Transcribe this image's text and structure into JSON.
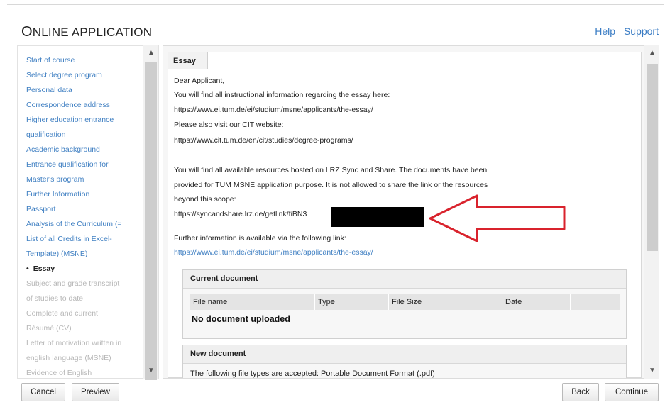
{
  "header": {
    "title_first": "O",
    "title_rest": "NLINE APPLICATION",
    "help": "Help",
    "support": "Support"
  },
  "sidebar": {
    "items": [
      {
        "label": "Start of course",
        "state": "link"
      },
      {
        "label": "Select degree program",
        "state": "link"
      },
      {
        "label": "Personal data",
        "state": "link"
      },
      {
        "label": "Correspondence address",
        "state": "link"
      },
      {
        "label": "Higher education entrance",
        "state": "link"
      },
      {
        "label": "qualification",
        "state": "link"
      },
      {
        "label": "Academic background",
        "state": "link"
      },
      {
        "label": "Entrance qualification for",
        "state": "link"
      },
      {
        "label": "Master's program",
        "state": "link"
      },
      {
        "label": "Further Information",
        "state": "link"
      },
      {
        "label": "Passport",
        "state": "link"
      },
      {
        "label": "Analysis of the Curriculum (=",
        "state": "link"
      },
      {
        "label": "List of all Credits in Excel-",
        "state": "link"
      },
      {
        "label": "Template) (MSNE)",
        "state": "link"
      },
      {
        "label": "Essay",
        "state": "active"
      },
      {
        "label": "Subject and grade transcript",
        "state": "disabled"
      },
      {
        "label": "of studies to date",
        "state": "disabled"
      },
      {
        "label": "Complete and current",
        "state": "disabled"
      },
      {
        "label": "Résumé (CV)",
        "state": "disabled"
      },
      {
        "label": "Letter of motivation written in",
        "state": "disabled"
      },
      {
        "label": "english language (MSNE)",
        "state": "disabled"
      },
      {
        "label": "Evidence of English",
        "state": "disabled"
      }
    ]
  },
  "main": {
    "tab_label": "Essay",
    "lines": {
      "l1": "Dear Applicant,",
      "l2": "You will find all instructional information regarding the essay here:",
      "l3": "https://www.ei.tum.de/ei/studium/msne/applicants/the-essay/",
      "l4": "Please also visit our CIT website:",
      "l5": "https://www.cit.tum.de/en/cit/studies/degree-programs/",
      "l6": "You will find all available resources hosted on LRZ Sync and Share. The documents have been",
      "l7": "provided for TUM MSNE application purpose. It is not allowed to share the link or the resources",
      "l8": "beyond this scope:",
      "l9": "https://syncandshare.lrz.de/getlink/fiBN3",
      "l10": "Further information is available via the following link:",
      "l11": "https://www.ei.tum.de/ei/studium/msne/applicants/the-essay/"
    },
    "current_document": {
      "title": "Current document",
      "columns": [
        "File name",
        "Type",
        "File Size",
        "Date"
      ],
      "empty_message": "No document uploaded"
    },
    "new_document": {
      "title": "New document",
      "accepted_text": "The following file types are accepted: Portable Document Format (.pdf)"
    }
  },
  "footer": {
    "cancel": "Cancel",
    "preview": "Preview",
    "back": "Back",
    "continue": "Continue"
  },
  "colors": {
    "link": "#3f7fc2",
    "annotation_arrow": "#d9232d"
  }
}
